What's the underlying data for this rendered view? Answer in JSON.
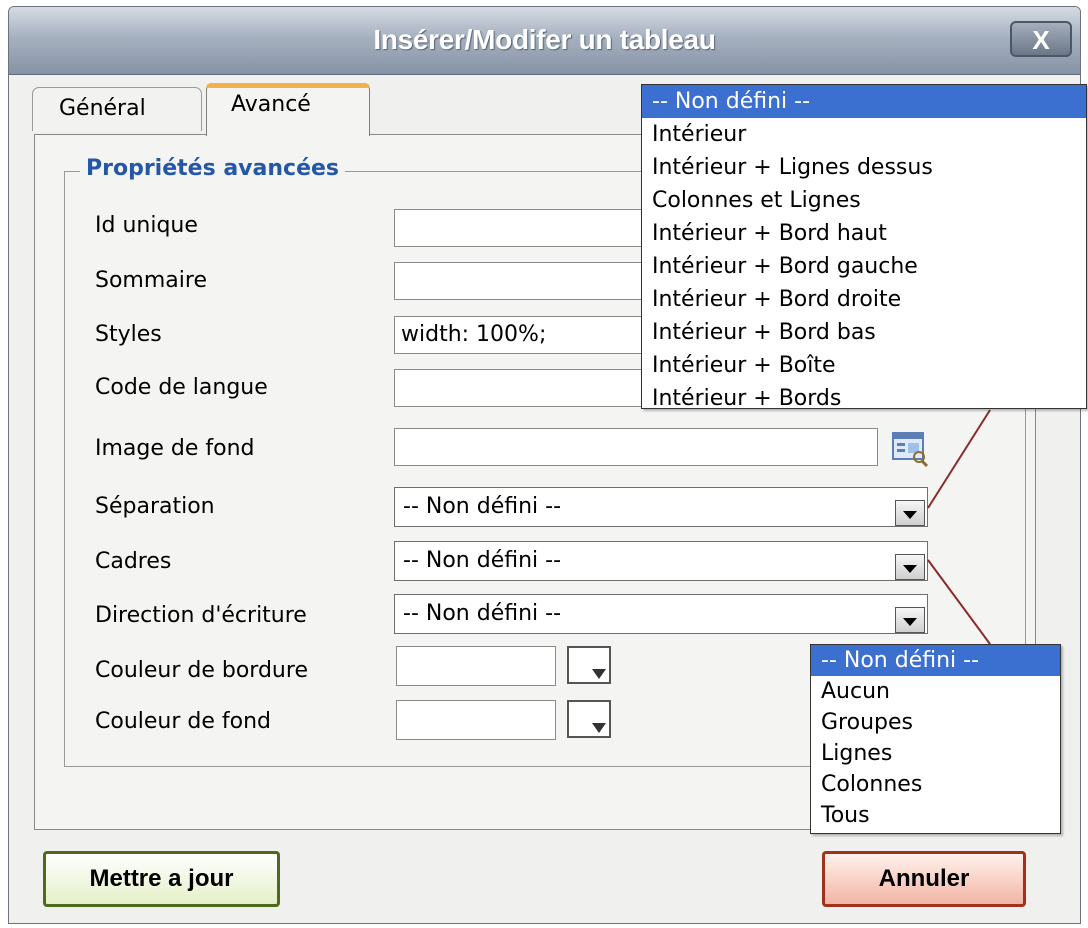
{
  "window": {
    "title": "Insérer/Modifer un tableau",
    "close_label": "X"
  },
  "tabs": [
    {
      "label": "Général",
      "active": false
    },
    {
      "label": "Avancé",
      "active": true
    }
  ],
  "section": {
    "legend": "Propriétés avancées"
  },
  "fields": {
    "id_unique": {
      "label": "Id unique",
      "value": ""
    },
    "sommaire": {
      "label": "Sommaire",
      "value": ""
    },
    "styles": {
      "label": "Styles",
      "value": "width: 100%;"
    },
    "code_langue": {
      "label": "Code de langue",
      "value": ""
    },
    "image_fond": {
      "label": "Image de fond",
      "value": ""
    },
    "separation": {
      "label": "Séparation",
      "value": "-- Non défini --"
    },
    "cadres": {
      "label": "Cadres",
      "value": "-- Non défini --"
    },
    "direction": {
      "label": "Direction d'écriture",
      "value": "-- Non défini --"
    },
    "couleur_bordure": {
      "label": "Couleur de bordure",
      "value": ""
    },
    "couleur_fond": {
      "label": "Couleur de fond",
      "value": ""
    }
  },
  "dropdown_separation": {
    "selected_index": 0,
    "options": [
      "-- Non défini --",
      "Intérieur",
      "Intérieur + Lignes dessus",
      "Colonnes et Lignes",
      "Intérieur + Bord haut",
      "Intérieur + Bord gauche",
      "Intérieur + Bord droite",
      "Intérieur + Bord bas",
      "Intérieur + Boîte",
      "Intérieur + Bords"
    ]
  },
  "dropdown_cadres": {
    "selected_index": 0,
    "options": [
      "-- Non défini --",
      "Aucun",
      "Groupes",
      "Lignes",
      "Colonnes",
      "Tous"
    ]
  },
  "buttons": {
    "update": "Mettre a jour",
    "cancel": "Annuler"
  },
  "colors": {
    "legend": "#2457a8",
    "highlight": "#3b6fd0",
    "update_border": "#4f6a1c",
    "cancel_border": "#a0321c",
    "connector": "#8b2a2a"
  },
  "icons": {
    "close": "close-icon",
    "browse": "browse-image-icon",
    "color_picker": "color-picker-icon",
    "dropdown_arrow": "chevron-down-icon"
  }
}
